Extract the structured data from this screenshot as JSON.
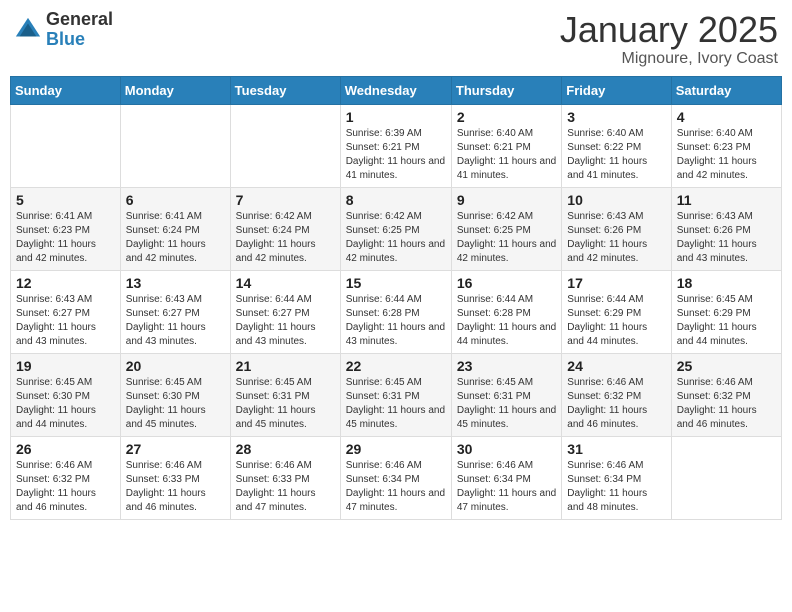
{
  "logo": {
    "general": "General",
    "blue": "Blue"
  },
  "header": {
    "month": "January 2025",
    "location": "Mignoure, Ivory Coast"
  },
  "weekdays": [
    "Sunday",
    "Monday",
    "Tuesday",
    "Wednesday",
    "Thursday",
    "Friday",
    "Saturday"
  ],
  "weeks": [
    [
      {
        "day": "",
        "sunrise": "",
        "sunset": "",
        "daylight": ""
      },
      {
        "day": "",
        "sunrise": "",
        "sunset": "",
        "daylight": ""
      },
      {
        "day": "",
        "sunrise": "",
        "sunset": "",
        "daylight": ""
      },
      {
        "day": "1",
        "sunrise": "Sunrise: 6:39 AM",
        "sunset": "Sunset: 6:21 PM",
        "daylight": "Daylight: 11 hours and 41 minutes."
      },
      {
        "day": "2",
        "sunrise": "Sunrise: 6:40 AM",
        "sunset": "Sunset: 6:21 PM",
        "daylight": "Daylight: 11 hours and 41 minutes."
      },
      {
        "day": "3",
        "sunrise": "Sunrise: 6:40 AM",
        "sunset": "Sunset: 6:22 PM",
        "daylight": "Daylight: 11 hours and 41 minutes."
      },
      {
        "day": "4",
        "sunrise": "Sunrise: 6:40 AM",
        "sunset": "Sunset: 6:23 PM",
        "daylight": "Daylight: 11 hours and 42 minutes."
      }
    ],
    [
      {
        "day": "5",
        "sunrise": "Sunrise: 6:41 AM",
        "sunset": "Sunset: 6:23 PM",
        "daylight": "Daylight: 11 hours and 42 minutes."
      },
      {
        "day": "6",
        "sunrise": "Sunrise: 6:41 AM",
        "sunset": "Sunset: 6:24 PM",
        "daylight": "Daylight: 11 hours and 42 minutes."
      },
      {
        "day": "7",
        "sunrise": "Sunrise: 6:42 AM",
        "sunset": "Sunset: 6:24 PM",
        "daylight": "Daylight: 11 hours and 42 minutes."
      },
      {
        "day": "8",
        "sunrise": "Sunrise: 6:42 AM",
        "sunset": "Sunset: 6:25 PM",
        "daylight": "Daylight: 11 hours and 42 minutes."
      },
      {
        "day": "9",
        "sunrise": "Sunrise: 6:42 AM",
        "sunset": "Sunset: 6:25 PM",
        "daylight": "Daylight: 11 hours and 42 minutes."
      },
      {
        "day": "10",
        "sunrise": "Sunrise: 6:43 AM",
        "sunset": "Sunset: 6:26 PM",
        "daylight": "Daylight: 11 hours and 42 minutes."
      },
      {
        "day": "11",
        "sunrise": "Sunrise: 6:43 AM",
        "sunset": "Sunset: 6:26 PM",
        "daylight": "Daylight: 11 hours and 43 minutes."
      }
    ],
    [
      {
        "day": "12",
        "sunrise": "Sunrise: 6:43 AM",
        "sunset": "Sunset: 6:27 PM",
        "daylight": "Daylight: 11 hours and 43 minutes."
      },
      {
        "day": "13",
        "sunrise": "Sunrise: 6:43 AM",
        "sunset": "Sunset: 6:27 PM",
        "daylight": "Daylight: 11 hours and 43 minutes."
      },
      {
        "day": "14",
        "sunrise": "Sunrise: 6:44 AM",
        "sunset": "Sunset: 6:27 PM",
        "daylight": "Daylight: 11 hours and 43 minutes."
      },
      {
        "day": "15",
        "sunrise": "Sunrise: 6:44 AM",
        "sunset": "Sunset: 6:28 PM",
        "daylight": "Daylight: 11 hours and 43 minutes."
      },
      {
        "day": "16",
        "sunrise": "Sunrise: 6:44 AM",
        "sunset": "Sunset: 6:28 PM",
        "daylight": "Daylight: 11 hours and 44 minutes."
      },
      {
        "day": "17",
        "sunrise": "Sunrise: 6:44 AM",
        "sunset": "Sunset: 6:29 PM",
        "daylight": "Daylight: 11 hours and 44 minutes."
      },
      {
        "day": "18",
        "sunrise": "Sunrise: 6:45 AM",
        "sunset": "Sunset: 6:29 PM",
        "daylight": "Daylight: 11 hours and 44 minutes."
      }
    ],
    [
      {
        "day": "19",
        "sunrise": "Sunrise: 6:45 AM",
        "sunset": "Sunset: 6:30 PM",
        "daylight": "Daylight: 11 hours and 44 minutes."
      },
      {
        "day": "20",
        "sunrise": "Sunrise: 6:45 AM",
        "sunset": "Sunset: 6:30 PM",
        "daylight": "Daylight: 11 hours and 45 minutes."
      },
      {
        "day": "21",
        "sunrise": "Sunrise: 6:45 AM",
        "sunset": "Sunset: 6:31 PM",
        "daylight": "Daylight: 11 hours and 45 minutes."
      },
      {
        "day": "22",
        "sunrise": "Sunrise: 6:45 AM",
        "sunset": "Sunset: 6:31 PM",
        "daylight": "Daylight: 11 hours and 45 minutes."
      },
      {
        "day": "23",
        "sunrise": "Sunrise: 6:45 AM",
        "sunset": "Sunset: 6:31 PM",
        "daylight": "Daylight: 11 hours and 45 minutes."
      },
      {
        "day": "24",
        "sunrise": "Sunrise: 6:46 AM",
        "sunset": "Sunset: 6:32 PM",
        "daylight": "Daylight: 11 hours and 46 minutes."
      },
      {
        "day": "25",
        "sunrise": "Sunrise: 6:46 AM",
        "sunset": "Sunset: 6:32 PM",
        "daylight": "Daylight: 11 hours and 46 minutes."
      }
    ],
    [
      {
        "day": "26",
        "sunrise": "Sunrise: 6:46 AM",
        "sunset": "Sunset: 6:32 PM",
        "daylight": "Daylight: 11 hours and 46 minutes."
      },
      {
        "day": "27",
        "sunrise": "Sunrise: 6:46 AM",
        "sunset": "Sunset: 6:33 PM",
        "daylight": "Daylight: 11 hours and 46 minutes."
      },
      {
        "day": "28",
        "sunrise": "Sunrise: 6:46 AM",
        "sunset": "Sunset: 6:33 PM",
        "daylight": "Daylight: 11 hours and 47 minutes."
      },
      {
        "day": "29",
        "sunrise": "Sunrise: 6:46 AM",
        "sunset": "Sunset: 6:34 PM",
        "daylight": "Daylight: 11 hours and 47 minutes."
      },
      {
        "day": "30",
        "sunrise": "Sunrise: 6:46 AM",
        "sunset": "Sunset: 6:34 PM",
        "daylight": "Daylight: 11 hours and 47 minutes."
      },
      {
        "day": "31",
        "sunrise": "Sunrise: 6:46 AM",
        "sunset": "Sunset: 6:34 PM",
        "daylight": "Daylight: 11 hours and 48 minutes."
      },
      {
        "day": "",
        "sunrise": "",
        "sunset": "",
        "daylight": ""
      }
    ]
  ]
}
